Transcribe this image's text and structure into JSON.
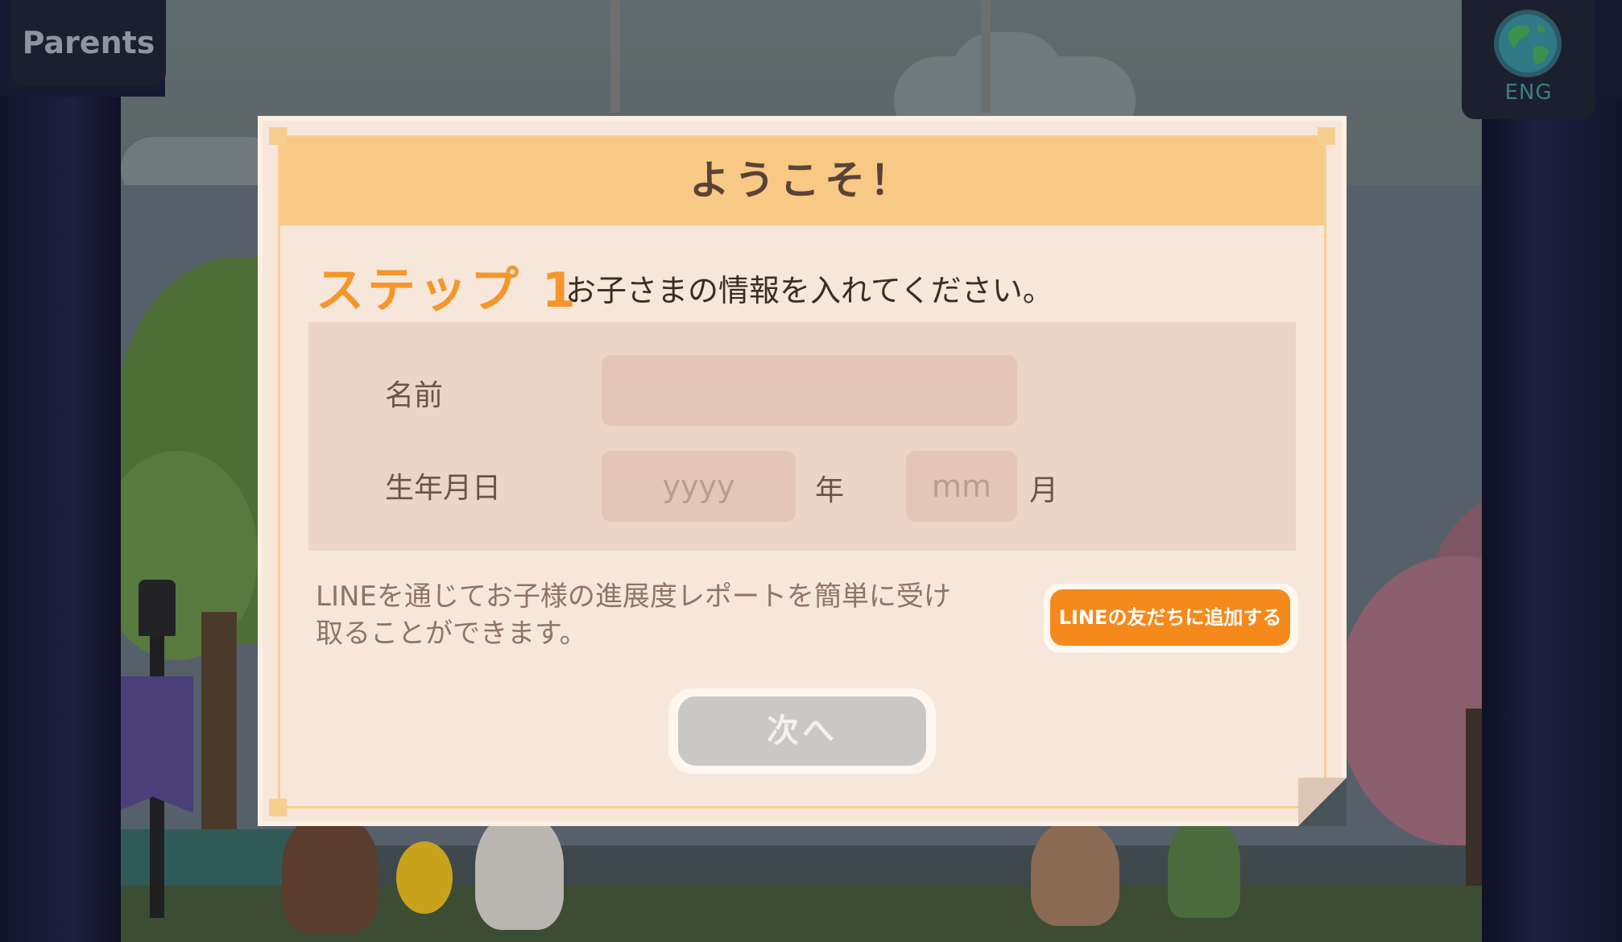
{
  "top_bar": {
    "parents_label": "Parents",
    "language_label": "ENG",
    "globe_icon": "globe-icon"
  },
  "dialog": {
    "title": "ようこそ！",
    "step_label": "ステップ 1",
    "step_description": "お子さまの情報を入れてください。",
    "name_label": "名前",
    "name_value": "",
    "birth_label": "生年月日",
    "year_placeholder": "yyyy",
    "year_unit": "年",
    "month_placeholder": "mm",
    "month_unit": "月",
    "line_info": "LINEを通じてお子様の進展度レポートを簡単に受け取ることができます。",
    "line_button_label": "LINEの友だちに追加する",
    "next_button_label": "次へ",
    "next_enabled": false
  },
  "colors": {
    "accent_orange": "#f5952a",
    "line_button": "#f5891c",
    "header_band": "#f8c885",
    "dialog_bg": "#f7e7da",
    "disabled_button": "#c9c8c6"
  }
}
